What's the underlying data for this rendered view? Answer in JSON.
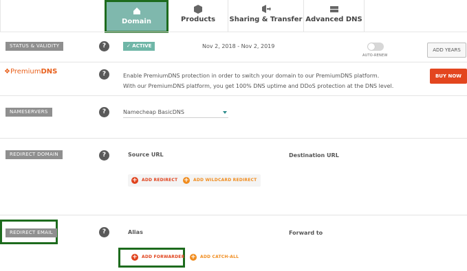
{
  "tabs": [
    {
      "label": "Domain",
      "icon": "house-icon",
      "active": true
    },
    {
      "label": "Products",
      "icon": "box-icon",
      "active": false
    },
    {
      "label": "Sharing & Transfer",
      "icon": "share-icon",
      "active": false
    },
    {
      "label": "Advanced DNS",
      "icon": "server-icon",
      "active": false
    }
  ],
  "status": {
    "label": "STATUS & VALIDITY",
    "help": "?",
    "badge": "✓ ACTIVE",
    "dates": "Nov 2, 2018 - Nov 2, 2019",
    "autorenew_label": "AUTO-RENEW",
    "add_years_button": "ADD YEARS"
  },
  "premium_dns": {
    "logo_prefix": "Premium",
    "logo_suffix": "DNS",
    "help": "?",
    "line1": "Enable PremiumDNS protection in order to switch your domain to our PremiumDNS platform.",
    "line2": "With our PremiumDNS platform, you get 100% DNS uptime and DDoS protection at the DNS level.",
    "buy_button": "BUY NOW"
  },
  "nameservers": {
    "label": "NAMESERVERS",
    "help": "?",
    "selected": "Namecheap BasicDNS"
  },
  "redirect_domain": {
    "label": "REDIRECT DOMAIN",
    "help": "?",
    "col_source": "Source URL",
    "col_destination": "Destination URL",
    "add_redirect": "ADD REDIRECT",
    "add_wildcard": "ADD WILDCARD REDIRECT"
  },
  "redirect_email": {
    "label": "REDIRECT EMAIL",
    "help": "?",
    "col_alias": "Alias",
    "col_forward": "Forward to",
    "add_forwarder": "ADD FORWARDER",
    "add_catch_all": "ADD CATCH-ALL"
  },
  "colors": {
    "accent_teal": "#7fb8ad",
    "highlight_green": "#1d6b1d",
    "buy_red": "#e3461f",
    "brand_orange": "#e8601c"
  }
}
